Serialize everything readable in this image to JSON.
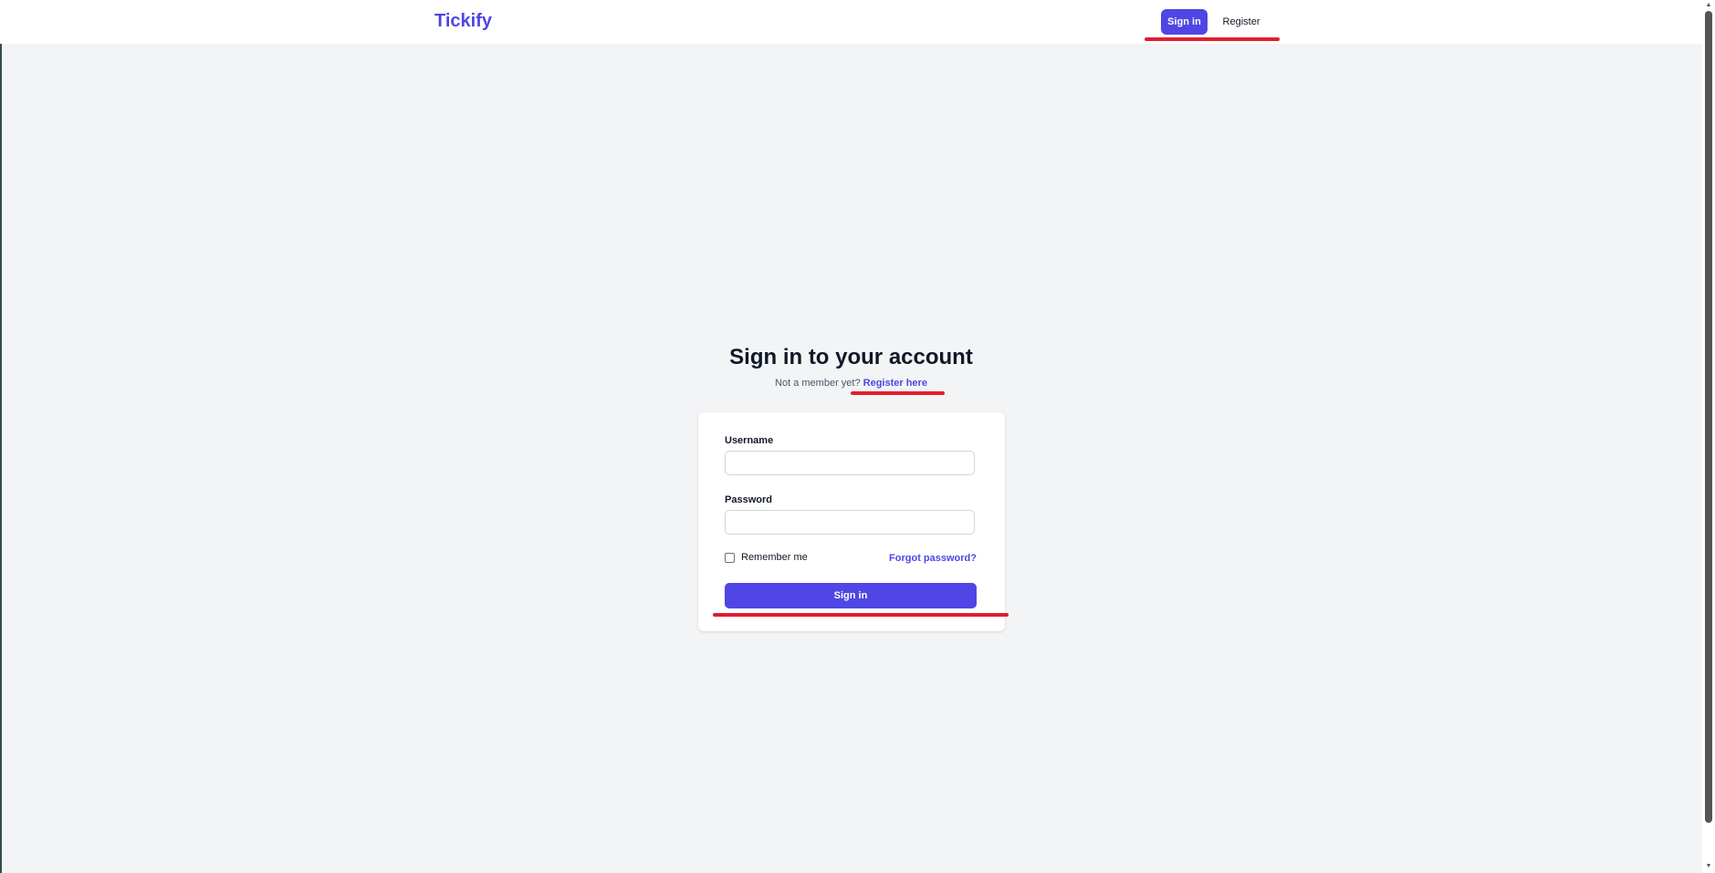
{
  "header": {
    "brand": "Tickify",
    "nav": {
      "signin_label": "Sign in",
      "register_label": "Register"
    }
  },
  "main": {
    "title": "Sign in to your account",
    "subtitle_prefix": "Not a member yet? ",
    "register_link": "Register here"
  },
  "form": {
    "username_label": "Username",
    "username_value": "",
    "password_label": "Password",
    "password_value": "",
    "remember_label": "Remember me",
    "remember_checked": false,
    "forgot_label": "Forgot password?",
    "submit_label": "Sign in"
  },
  "scrollbar": {
    "up_icon": "chevron-up-icon",
    "down_icon": "chevron-down-icon"
  },
  "colors": {
    "accent": "#4f46e5",
    "background": "#f3f4f6",
    "annotation": "#e11d2e"
  }
}
